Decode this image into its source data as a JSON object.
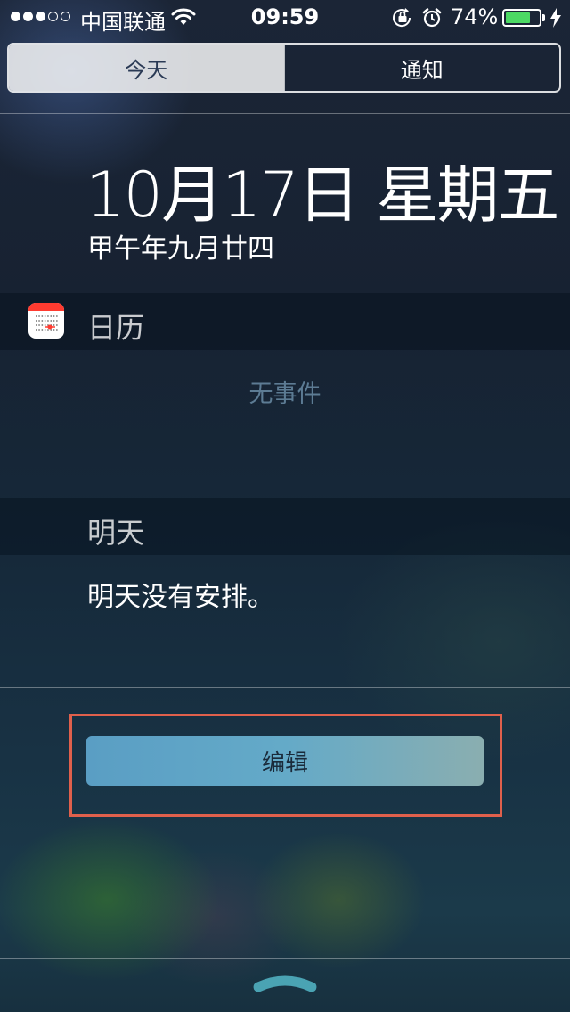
{
  "status_bar": {
    "signal_dots_filled": 3,
    "signal_dots_total": 5,
    "carrier": "中国联通",
    "time": "09:59",
    "battery_percent": "74%",
    "battery_level": 0.74,
    "icons": [
      "wifi-icon",
      "rotation-lock-icon",
      "alarm-icon",
      "charging-icon"
    ],
    "battery_fill_color": "#4cd964"
  },
  "tabs": [
    {
      "label": "今天",
      "active": true
    },
    {
      "label": "通知",
      "active": false
    }
  ],
  "today": {
    "date": "10月17日 星期五",
    "lunar_date": "甲午年九月廿四"
  },
  "calendar": {
    "title": "日历",
    "icon": "calendar-app-icon",
    "empty_text": "无事件"
  },
  "tomorrow": {
    "title": "明天",
    "summary": "明天没有安排。"
  },
  "edit_button": {
    "label": "编辑",
    "highlight_color": "#e0604c"
  }
}
